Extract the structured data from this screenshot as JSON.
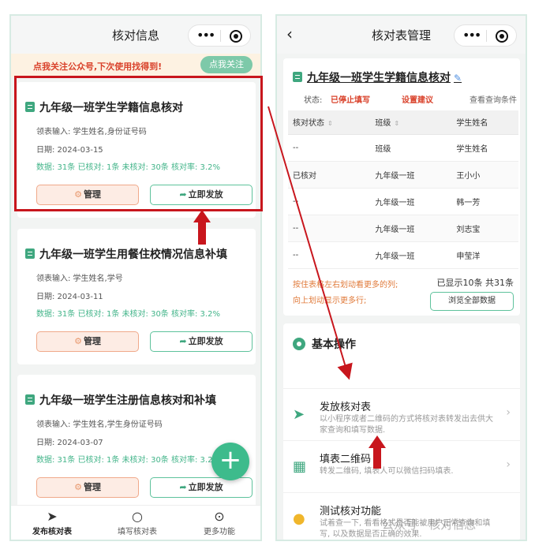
{
  "left": {
    "nav_title": "核对信息",
    "follow_text": "点我关注公众号,下次使用找得到!",
    "follow_button": "点我关注",
    "cards": [
      {
        "title": "九年级一班学生学籍信息核对",
        "fields": "领表输入: 学生姓名,身份证号码",
        "date": "日期: 2024-03-15",
        "stats": "数据: 31条 已核对: 1条 未核对: 30条 核对率: 3.2%",
        "manage": "管理",
        "send": "立即发放"
      },
      {
        "title": "九年级一班学生用餐住校情况信息补填",
        "fields": "领表输入: 学生姓名,学号",
        "date": "日期: 2024-03-11",
        "stats": "数据: 31条 已核对: 1条 未核对: 30条 核对率: 3.2%",
        "manage": "管理",
        "send": "立即发放"
      },
      {
        "title": "九年级一班学生注册信息核对和补填",
        "fields": "领表输入: 学生姓名,学生身份证号码",
        "date": "日期: 2024-03-07",
        "stats": "数据: 31条 已核对: 1条 未核对: 30条 核对率: 3.2%",
        "manage": "管理",
        "send": "立即发放"
      }
    ],
    "fab": "+",
    "tabs": [
      {
        "label": "发布核对表",
        "icon": "send-icon"
      },
      {
        "label": "填写核对表",
        "icon": "search-icon"
      },
      {
        "label": "更多功能",
        "icon": "more-icon"
      }
    ]
  },
  "right": {
    "nav_title": "核对表管理",
    "table_title": "九年级一班学生学籍信息核对",
    "status_label": "状态:",
    "status_value": "已停止填写",
    "suggest": "设置建议",
    "query": "查看查询条件",
    "columns": [
      "核对状态",
      "班级",
      "学生姓名"
    ],
    "rows": [
      [
        "--",
        "班级",
        "学生姓名"
      ],
      [
        "已核对",
        "九年级一班",
        "王小小"
      ],
      [
        "--",
        "九年级一班",
        "韩一芳"
      ],
      [
        "--",
        "九年级一班",
        "刘志宝"
      ],
      [
        "--",
        "九年级一班",
        "申莹洋"
      ]
    ],
    "hint1": "按住表格左右划动看更多的列;",
    "hint2": "向上划动显示更多行;",
    "shown": "已显示10条 共31条",
    "browse": "浏览全部数据",
    "ops_title": "基本操作",
    "ops": [
      {
        "name": "发放核对表",
        "desc": "以小程序或者二维码的方式将核对表转发出去供大家查询和填写数据.",
        "icon": "paper-plane-icon"
      },
      {
        "name": "填表二维码",
        "desc": "转发二维码, 填表人可以微信扫码填表.",
        "icon": "qr-code-icon"
      },
      {
        "name": "测试核对功能",
        "desc": "试着查一下, 看看格式是否能被用户正常查询和填写, 以及数据是否正确的效果.",
        "icon": "test-icon"
      }
    ]
  },
  "watermark": "公众号 · 核对信息",
  "colors": {
    "accent": "#3fa77f",
    "highlight": "#c8161d",
    "warn": "#d9412a"
  }
}
